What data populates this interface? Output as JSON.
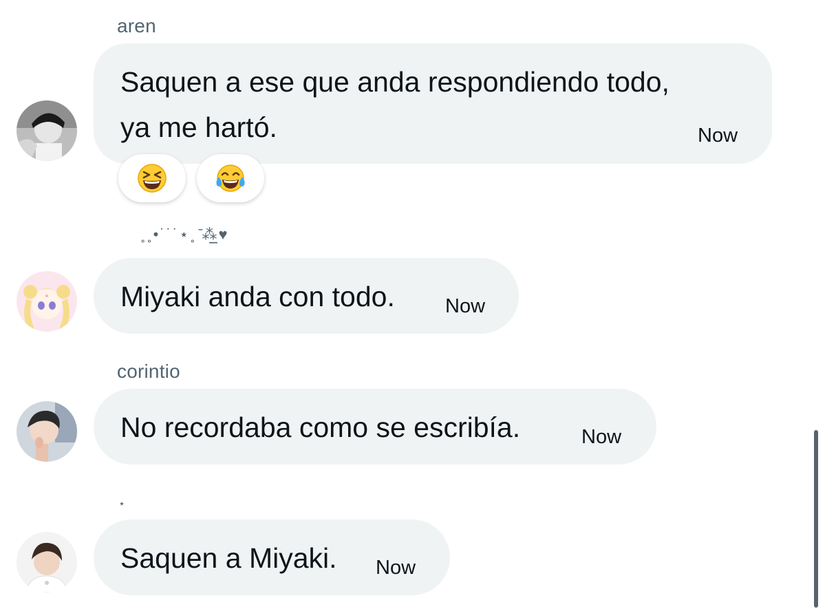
{
  "messages": [
    {
      "sender": "aren",
      "lines": [
        "Saquen a ese que anda respondiendo todo,",
        "ya me hartó."
      ],
      "time": "Now",
      "reactions": [
        "grinning-squinting-face",
        "face-with-tears-of-joy"
      ]
    },
    {
      "sender_decoration": "˳˳•˙˙˙⋆˳ ̄⁂̲̲̲̲♥",
      "lines": [
        "Miyaki anda con todo."
      ],
      "time": "Now"
    },
    {
      "sender": "corintio",
      "lines": [
        "No recordaba como se escribía."
      ],
      "time": "Now"
    },
    {
      "sender_decoration": "⋆",
      "lines": [
        "Saquen a Miyaki."
      ],
      "time": "Now"
    }
  ],
  "colors": {
    "bubble": "#eff3f4",
    "text": "#0f1419",
    "secondary_text": "#536471"
  }
}
